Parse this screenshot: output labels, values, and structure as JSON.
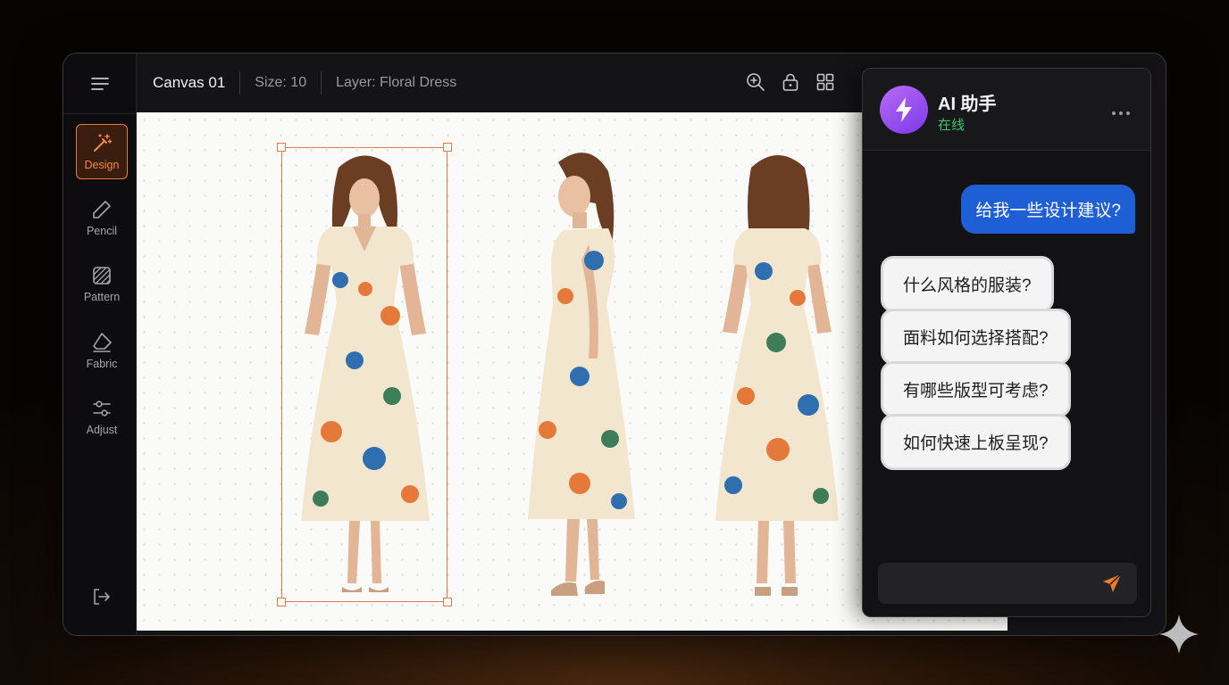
{
  "toolbar": {
    "canvas_name": "Canvas 01",
    "size_label": "Size: 10",
    "layer_label": "Layer: Floral Dress"
  },
  "sidebar": {
    "items": [
      {
        "label": "Design",
        "icon": "magic-wand-icon",
        "active": true
      },
      {
        "label": "Pencil",
        "icon": "pencil-icon",
        "active": false
      },
      {
        "label": "Pattern",
        "icon": "pattern-icon",
        "active": false
      },
      {
        "label": "Fabric",
        "icon": "fabric-icon",
        "active": false
      },
      {
        "label": "Adjust",
        "icon": "sliders-icon",
        "active": false
      }
    ]
  },
  "assistant": {
    "name": "AI 助手",
    "status": "在线",
    "user_message": "给我一些设计建议?",
    "suggestions": [
      "什么风格的服装?",
      "面料如何选择搭配?",
      "有哪些版型可考虑?",
      "如何快速上板呈现?"
    ]
  },
  "colors": {
    "accent": "#e87a3a",
    "user_bubble": "#1e5fd6",
    "status_online": "#3ec56a",
    "avatar": "#9b4ff0"
  }
}
